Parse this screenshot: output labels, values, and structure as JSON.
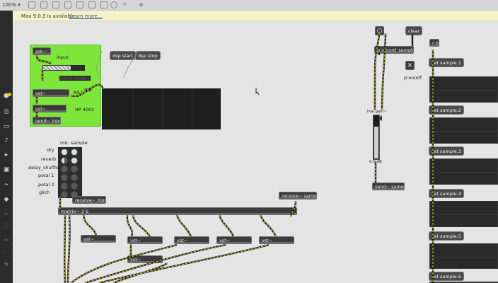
{
  "window": {
    "zoom_label": "100% ▾"
  },
  "notice": {
    "text": "Max 9.0.3 is available",
    "link": "Learn more..."
  },
  "green_panel": {
    "adc": "adc~ 1",
    "input_label": "input",
    "vst_ns1": "vst~",
    "ns1_label": "NS1",
    "vst_hp": "vst~",
    "hp_label": "HP 40hz",
    "send_input": "send~ input"
  },
  "dsp": {
    "start": "dsp start",
    "stop": "dsp stop"
  },
  "mixer": {
    "header_mic": "mic",
    "header_sample": "sample",
    "rows": [
      "dry",
      "reverb",
      "delay_shuffle",
      "potal 1",
      "potal 2",
      "glich"
    ],
    "receive_input": "receive~ input",
    "matrix": "matrix~ 2 6",
    "receive_sample": "receive~ sample",
    "vsts": [
      "vst~",
      "vst~",
      "vst~",
      "vst~",
      "vst~",
      "vst~"
    ],
    "vst_low": "vst~"
  },
  "recorder": {
    "clear": "clear",
    "p_record": "p record_sample",
    "onoff_label": "p:on/off",
    "live_gain": "live.gain~",
    "db_readout": "0.0 dB",
    "gain_level": 0.72,
    "send_sample": "send~ sample"
  },
  "samples": {
    "rb": "r b",
    "buttons": [
      "set sample.1",
      "set sample.2",
      "set sample.3",
      "set sample.4",
      "set sample.5",
      "set sample.6"
    ]
  },
  "colors": {
    "accent_green": "#7ee53a",
    "cord_yellow": "#c9c93b",
    "notice_bg": "#f8f1c8"
  },
  "icons": {
    "sidebar": [
      "package-icon",
      "target-icon",
      "browser-icon",
      "music-note-icon",
      "clip-icon",
      "image-icon",
      "paperclip-icon",
      "speaker-icon",
      "link-icon",
      "info-icon",
      "expand-icon",
      "dots-icon",
      "star-icon"
    ]
  }
}
